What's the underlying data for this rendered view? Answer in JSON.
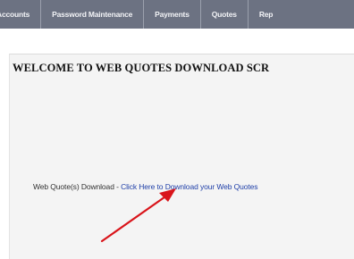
{
  "nav": {
    "items": [
      {
        "label": "Accounts"
      },
      {
        "label": "Password Maintenance"
      },
      {
        "label": "Payments"
      },
      {
        "label": "Quotes"
      },
      {
        "label": "Rep"
      }
    ]
  },
  "main": {
    "title": "WELCOME TO WEB QUOTES DOWNLOAD SCR",
    "download_label": "Web Quote(s) Download - ",
    "download_link": "Click Here to Download your Web Quotes"
  },
  "annotation": {
    "arrow_color": "#d9141a"
  },
  "colors": {
    "nav_background": "#6c7282",
    "link": "#1f3fa8",
    "content_background": "#f4f4f4"
  }
}
